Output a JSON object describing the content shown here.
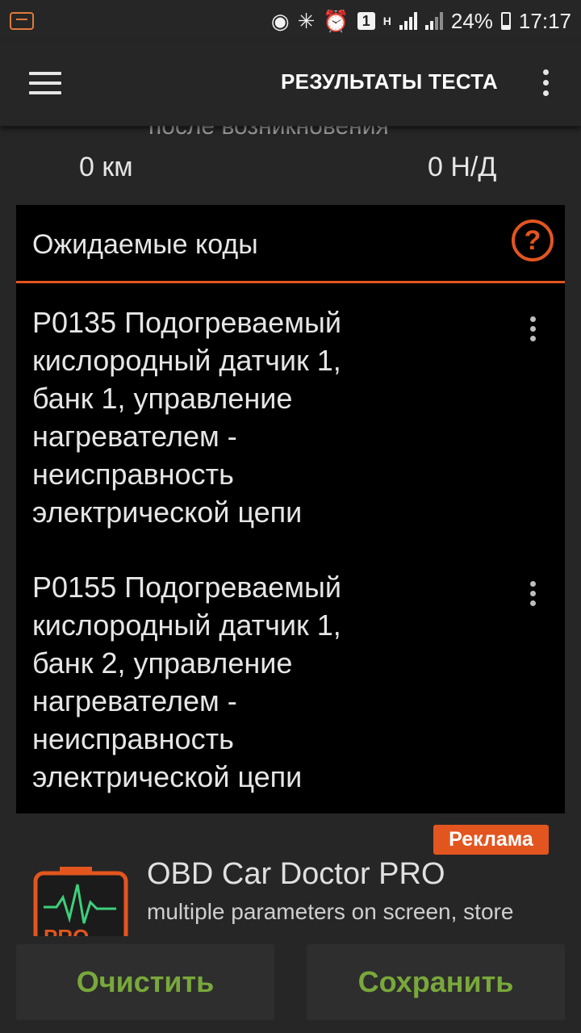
{
  "status_bar": {
    "left_icon": "car-doctor-notification-icon",
    "icons": [
      "location-icon",
      "bluetooth-icon",
      "alarm-icon",
      "sim-1-icon",
      "network-h-icon",
      "signal-icon",
      "signal-icon"
    ],
    "sim_label": "1",
    "network_label": "H",
    "battery": "24%",
    "time": "17:17"
  },
  "app_bar": {
    "title": "РЕЗУЛЬТАТЫ ТЕСТА",
    "menu_icon": "hamburger-icon",
    "overflow_icon": "more-vert-icon"
  },
  "previous_row": {
    "label_partial": "после возникновения",
    "distance": "0 км",
    "value": "0 Н/Д"
  },
  "pending_codes": {
    "title": "Ожидаемые коды",
    "help_icon": "?",
    "items": [
      {
        "code": "P0135",
        "text": "Подогреваемый кислородный датчик 1, банк 1, управление нагревателем - неисправность электрической цепи"
      },
      {
        "code": "P0155",
        "text": "Подогреваемый кислородный датчик 1, банк 2, управление нагревателем - неисправность электрической цепи"
      }
    ]
  },
  "ad": {
    "badge": "Реклама",
    "title": "OBD Car Doctor PRO",
    "subtitle": "multiple parameters on screen, store",
    "icon_text": "PRO"
  },
  "buttons": {
    "clear": "Очистить",
    "save": "Сохранить"
  },
  "colors": {
    "accent": "#e3551f",
    "button_text": "#79a83b",
    "background": "#262626",
    "panel": "#000000"
  }
}
